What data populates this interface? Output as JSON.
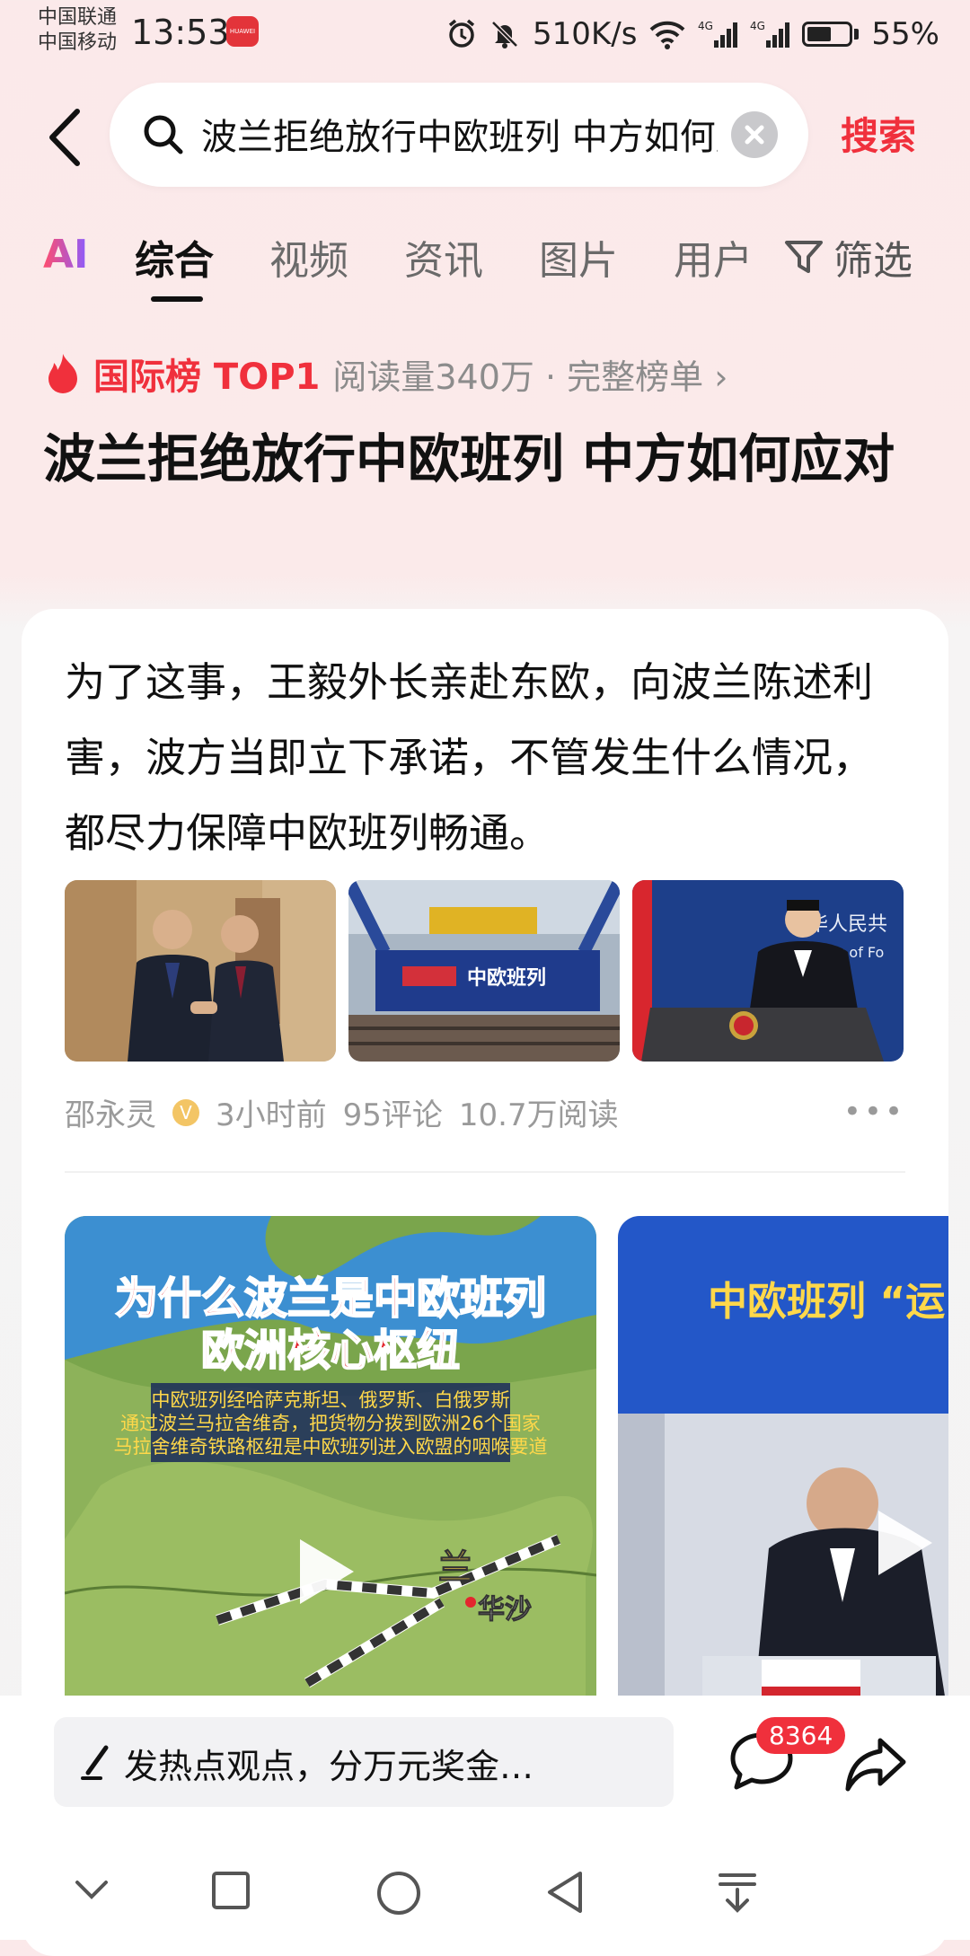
{
  "status_bar": {
    "carrier_1": "中国联通",
    "carrier_2": "中国移动",
    "time": "13:53",
    "speed": "510K/s",
    "signal_1": "4G",
    "signal_2": "4G",
    "battery": "55%"
  },
  "search": {
    "query": "波兰拒绝放行中欧班列 中方如何应对",
    "search_label": "搜索"
  },
  "tabs": {
    "ai": "AI",
    "items": [
      "综合",
      "视频",
      "资讯",
      "图片",
      "用户"
    ],
    "active": "综合",
    "filter": "筛选"
  },
  "hot": {
    "rank": "国际榜 TOP1",
    "meta": "阅读量340万 · 完整榜单 ›"
  },
  "page_title": "波兰拒绝放行中欧班列 中方如何应对",
  "article": {
    "text": "为了这事，王毅外长亲赴东欧，向波兰陈述利害，波方当即立下承诺，不管发生什么情况，都尽力保障中欧班列畅通。",
    "author": "邵永灵",
    "time": "3小时前",
    "comments": "95评论",
    "reads": "10.7万阅读",
    "image_2_logo": "中欧班列",
    "image_3_text": "华人民共",
    "image_3_text2": "try of Fo"
  },
  "videos": {
    "v1_title_1": "为什么波兰是中欧班列",
    "v1_title_2": "欧洲核心枢纽",
    "v1_line_1": "中欧班列经哈萨克斯坦、俄罗斯、白俄罗斯",
    "v1_line_2": "通过波兰马拉舍维奇，把货物分拨到欧洲26个国家",
    "v1_line_3": "马拉舍维奇铁路枢纽是中欧班列进入欧盟的咽喉要道",
    "v1_map_label_1": "兰",
    "v1_map_label_2": "华沙",
    "v2_banner": "中欧班列 “运"
  },
  "bottom": {
    "comment_placeholder": "发热点观点，分万元奖金…",
    "comment_count": "8364"
  },
  "colors": {
    "accent": "#f0303c",
    "bg_pink": "#fbe9ea"
  }
}
